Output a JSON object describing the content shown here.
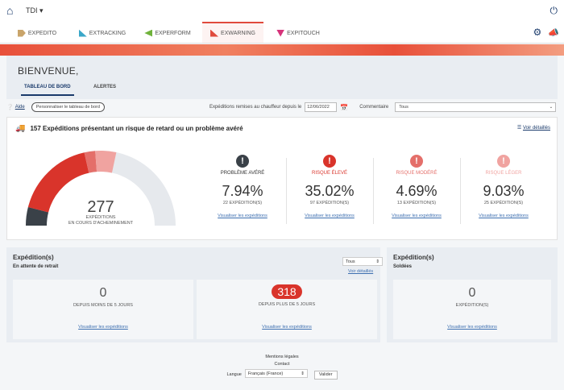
{
  "topbar": {
    "home_icon": "home-icon",
    "company": "TDI ▾",
    "power_icon": "power-icon"
  },
  "apps": [
    {
      "label": "EXPEDITO",
      "color": "#c9a46a"
    },
    {
      "label": "EXTRACKING",
      "color": "#3aa7c9"
    },
    {
      "label": "EXPERFORM",
      "color": "#6fb23a"
    },
    {
      "label": "EXWARNING",
      "color": "#e04a3c"
    },
    {
      "label": "EXPITOUCH",
      "color": "#d6337a"
    }
  ],
  "welcome": {
    "title": "BIENVENUE,",
    "tabs": [
      "TABLEAU DE BORD",
      "ALERTES"
    ]
  },
  "toolbar": {
    "help": "Aide",
    "customize": "Personnaliser le tableau de bord",
    "date_label": "Expéditions remises au chauffeur depuis le",
    "date_value": "12/06/2022",
    "comment_label": "Commentaire",
    "comment_value": "Tous"
  },
  "risk": {
    "title": "157 Expéditions présentant un risque de retard ou un problème avéré",
    "details_link": "Voir détaillés",
    "total": "277",
    "total_label1": "EXPÉDITIONS",
    "total_label2": "EN COURS D'ACHEMINEMENT",
    "gauge_segments": [
      {
        "name": "Problème avéré",
        "share": 0.0794,
        "color": "#3a4148"
      },
      {
        "name": "Risque élevé",
        "share": 0.3502,
        "color": "#d9342b"
      },
      {
        "name": "Risque modéré",
        "share": 0.0469,
        "color": "#e46f6a"
      },
      {
        "name": "Risque léger",
        "share": 0.0903,
        "color": "#f0a3a0"
      }
    ],
    "gauge_rest_color": "#e6e9ed",
    "categories": [
      {
        "label": "PROBLÈME AVÉRÉ",
        "pct": "7.94%",
        "count": "22 EXPÉDITION(S)",
        "link": "Visualiser les expéditions",
        "color": "#3a4148"
      },
      {
        "label": "RISQUE ÉLEVÉ",
        "pct": "35.02%",
        "count": "97 EXPÉDITION(S)",
        "link": "Visualiser les expéditions",
        "color": "#d9342b"
      },
      {
        "label": "RISQUE MODÉRÉ",
        "pct": "4.69%",
        "count": "13 EXPÉDITION(S)",
        "link": "Visualiser les expéditions",
        "color": "#e46f6a"
      },
      {
        "label": "RISQUE LÉGER",
        "pct": "9.03%",
        "count": "25 EXPÉDITION(S)",
        "link": "Visualiser les expéditions",
        "color": "#f0a3a0"
      }
    ]
  },
  "retrait": {
    "title": "Expédition(s)",
    "subtitle": "En attente de retrait",
    "select_value": "Tous",
    "details_link": "Voir détaillés",
    "cells": [
      {
        "value": "0",
        "label": "DEPUIS MOINS DE 5 JOURS",
        "link": "Visualiser les expéditions"
      },
      {
        "value": "318",
        "label": "DEPUIS PLUS DE 5 JOURS",
        "link": "Visualiser les expéditions"
      }
    ]
  },
  "soldees": {
    "title": "Expédition(s)",
    "subtitle": "Soldées",
    "value": "0",
    "label": "EXPÉDITION(S)",
    "link": "Visualiser les expéditions"
  },
  "footer": {
    "legal": "Mentions légales",
    "contact": "Contact",
    "lang_label": "Langue",
    "lang_value": "Français (France)",
    "validate": "Valider"
  }
}
